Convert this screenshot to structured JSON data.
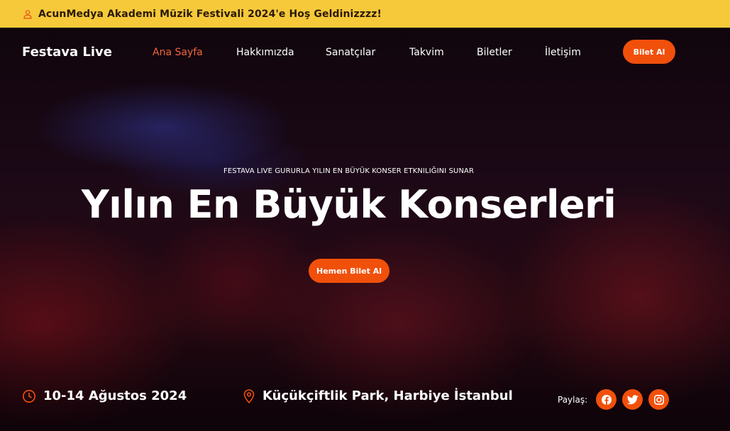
{
  "announcement": {
    "text": "AcunMedya Akademi Müzik Festivali 2024'e Hoş Geldinizzzz!",
    "icon": "user-icon"
  },
  "nav": {
    "brand": "Festava Live",
    "links": [
      {
        "label": "Ana Sayfa",
        "active": true
      },
      {
        "label": "Hakkımızda",
        "active": false
      },
      {
        "label": "Sanatçılar",
        "active": false
      },
      {
        "label": "Takvim",
        "active": false
      },
      {
        "label": "Biletler",
        "active": false
      },
      {
        "label": "İletişim",
        "active": false
      }
    ],
    "button": "Bilet Al"
  },
  "hero": {
    "tagline": "FESTAVA LIVE GURURLA YILIN EN BÜYÜK KONSER ETKNILIĞINI SUNAR",
    "title": "Yılın En Büyük Konserleri",
    "cta": "Hemen Bilet Al"
  },
  "info": {
    "date": "10-14 Ağustos 2024",
    "date_icon": "clock-icon",
    "location": "Küçükçiftlik Park, Harbiye İstanbul",
    "location_icon": "map-pin-icon"
  },
  "share": {
    "label": "Paylaş:",
    "icons": [
      "facebook-icon",
      "twitter-icon",
      "instagram-icon"
    ]
  },
  "colors": {
    "accent": "#f1500b",
    "announcement_bg": "#f6c93a",
    "active_link": "#f2653a"
  }
}
